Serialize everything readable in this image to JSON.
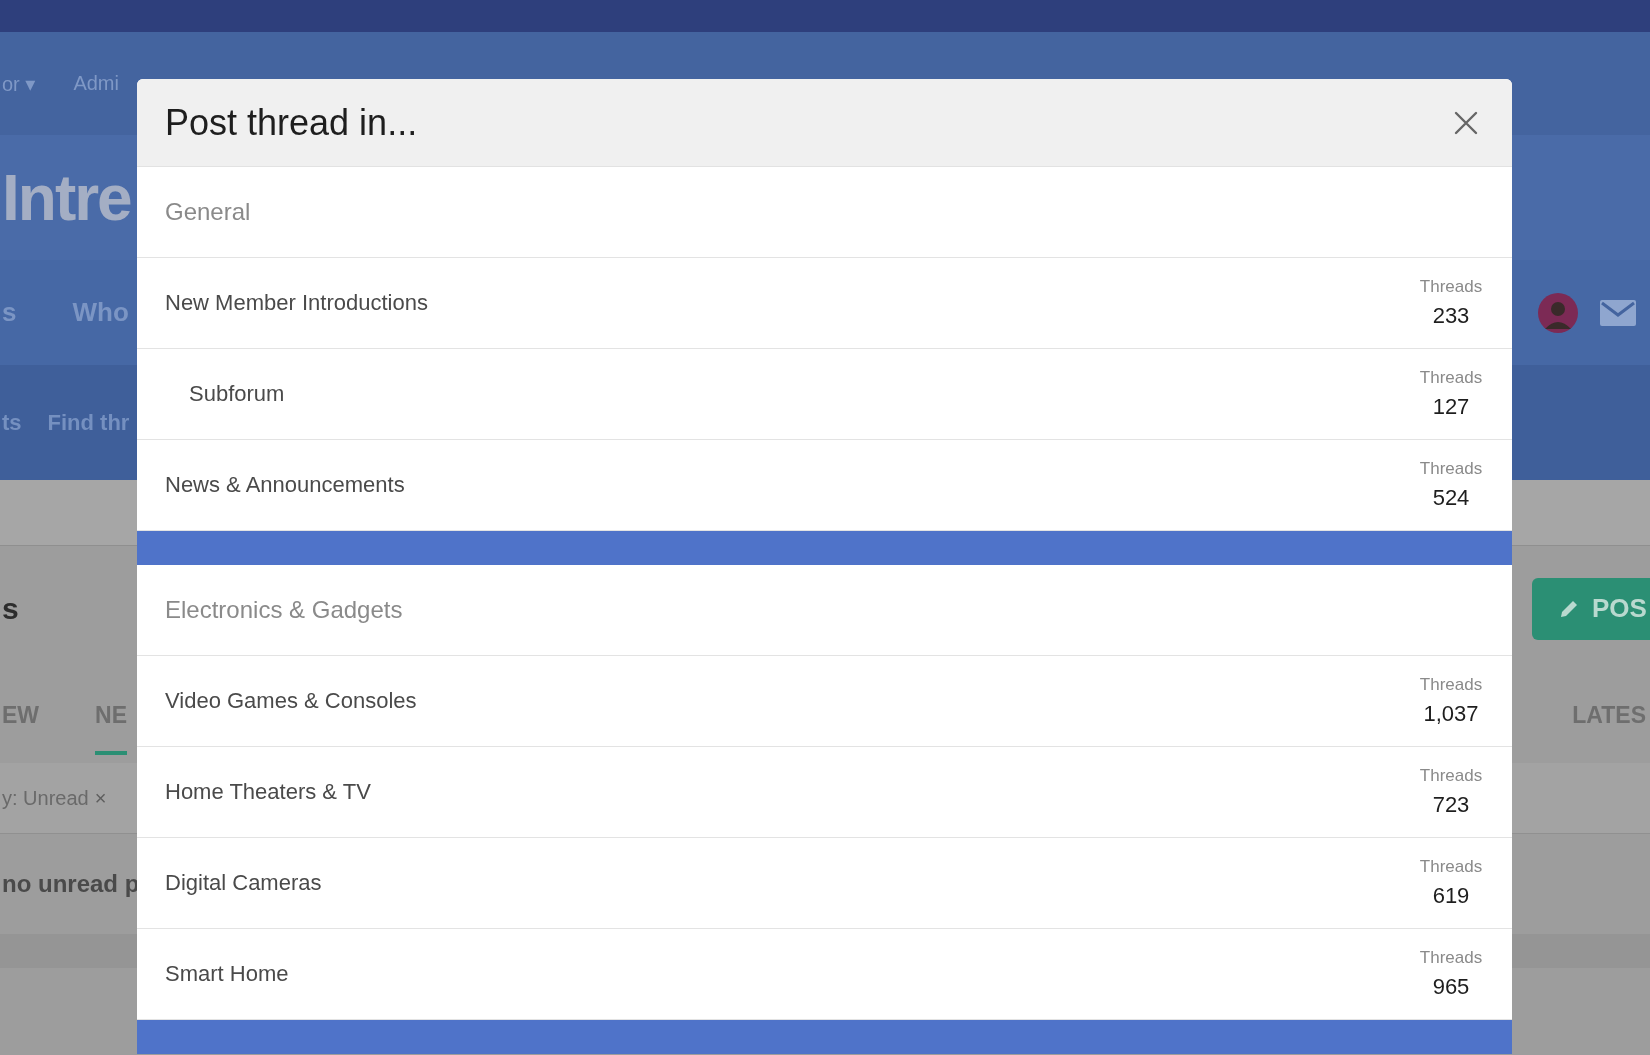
{
  "page": {
    "top_links": [
      "or ▾",
      "Admi"
    ],
    "logo": "Intre",
    "nav_tabs": [
      "s",
      "Who"
    ],
    "sub_links": [
      "ts",
      "Find thr"
    ],
    "page_title": "s",
    "post_button": "POS",
    "content_tabs": [
      {
        "label": "EW",
        "selected": false
      },
      {
        "label": "NE",
        "selected": true
      },
      {
        "label": "LATES",
        "selected": false
      }
    ],
    "filter": {
      "label": "y: Unread",
      "remove": "×"
    },
    "message": "no unread p"
  },
  "modal": {
    "title": "Post thread in...",
    "sections": [
      {
        "title": "General",
        "forums": [
          {
            "name": "New Member Introductions",
            "count_label": "Threads",
            "count": "233",
            "children": [
              {
                "name": "Subforum",
                "count_label": "Threads",
                "count": "127"
              }
            ]
          },
          {
            "name": "News & Announcements",
            "count_label": "Threads",
            "count": "524"
          }
        ]
      },
      {
        "title": "Electronics & Gadgets",
        "forums": [
          {
            "name": "Video Games & Consoles",
            "count_label": "Threads",
            "count": "1,037"
          },
          {
            "name": "Home Theaters & TV",
            "count_label": "Threads",
            "count": "723"
          },
          {
            "name": "Digital Cameras",
            "count_label": "Threads",
            "count": "619"
          },
          {
            "name": "Smart Home",
            "count_label": "Threads",
            "count": "965"
          }
        ]
      }
    ]
  }
}
